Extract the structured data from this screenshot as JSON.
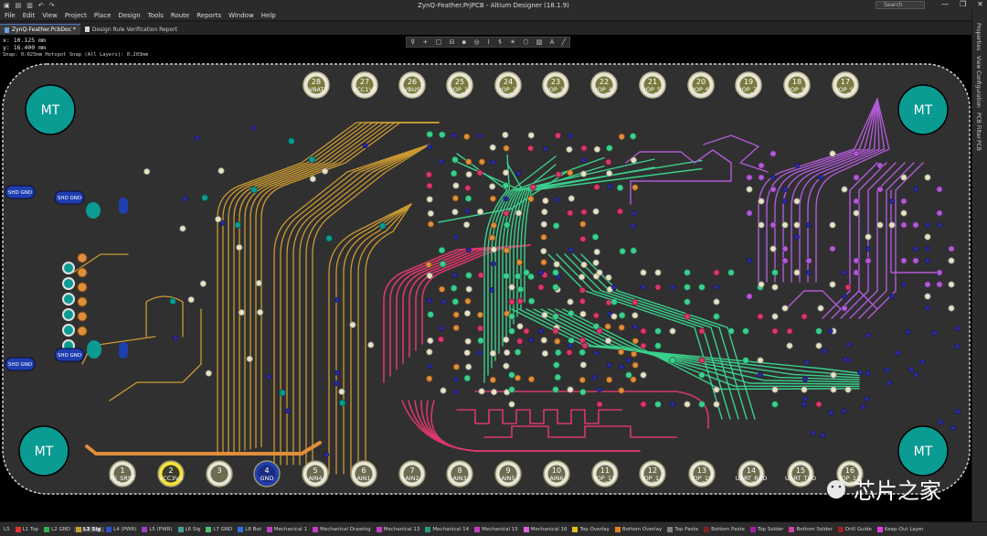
{
  "window": {
    "title": "ZynQ-Feather.PrjPCB - Altium Designer (18.1.9)",
    "search_placeholder": "Search",
    "controls": [
      "—",
      "❐",
      "✕"
    ]
  },
  "menubar": [
    "File",
    "Edit",
    "View",
    "Project",
    "Place",
    "Design",
    "Tools",
    "Route",
    "Reports",
    "Window",
    "Help"
  ],
  "tabs": [
    {
      "label": "ZynQ-Feather.PcbDoc *",
      "active": true
    },
    {
      "label": "Design Rule Verification Report",
      "active": false
    }
  ],
  "status": {
    "x": "x:  10.125 mm",
    "y": "y:  16.400 mm",
    "snap": "Snap: 0.025mm Hotspot Snap (All Layers): 0.203mm"
  },
  "toolbar_icons": [
    "filter-icon",
    "add-icon",
    "rect-select-icon",
    "align-icon",
    "place-component-icon",
    "hole-icon",
    "route-icon",
    "diffpair-icon",
    "bulb-icon",
    "polygon-icon",
    "region-icon",
    "text-icon",
    "line-icon"
  ],
  "right_panel": [
    "Properties",
    "View Configuration",
    "PCB Filter",
    "PCB"
  ],
  "pcb": {
    "colors": {
      "board": "#303030",
      "bottom_pad": "#e8e3c0",
      "mount": "#0a9b93",
      "orange": "#e08e3a",
      "gold": "#cc9a32",
      "green": "#3bd08c",
      "pink": "#d8386a",
      "purple": "#b15bd6",
      "via": "#2a2aa0"
    },
    "mount_label": "MT",
    "top_pads": [
      {
        "num": "28",
        "name": "VBAT"
      },
      {
        "num": "27",
        "name": "VCC1V0"
      },
      {
        "num": "26",
        "name": "VBUS"
      },
      {
        "num": "25",
        "name": "IOP_1"
      },
      {
        "num": "24",
        "name": "IOP_2"
      },
      {
        "num": "23",
        "name": "IOP_3"
      },
      {
        "num": "22",
        "name": "IOP_4"
      },
      {
        "num": "21",
        "name": "IOP_5"
      },
      {
        "num": "20",
        "name": "IOP_6"
      },
      {
        "num": "19",
        "name": "IOP_7"
      },
      {
        "num": "18",
        "name": "IOP_8"
      },
      {
        "num": "17",
        "name": "IOP_9"
      }
    ],
    "bottom_pads": [
      {
        "num": "1",
        "name": "PS_SRST"
      },
      {
        "num": "2",
        "name": "VCC3V3"
      },
      {
        "num": "3",
        "name": ""
      },
      {
        "num": "4",
        "name": "GND"
      },
      {
        "num": "5",
        "name": "AIN4"
      },
      {
        "num": "6",
        "name": "AIN1"
      },
      {
        "num": "7",
        "name": "AIN2"
      },
      {
        "num": "8",
        "name": "AIN3"
      },
      {
        "num": "9",
        "name": "AIN5"
      },
      {
        "num": "10",
        "name": "AIN6"
      },
      {
        "num": "11",
        "name": "IOP_12"
      },
      {
        "num": "12",
        "name": "IOP_11"
      },
      {
        "num": "13",
        "name": "IOP_10"
      },
      {
        "num": "14",
        "name": "UART_RXD"
      },
      {
        "num": "15",
        "name": "UART_TXD"
      },
      {
        "num": "16",
        "name": "IOP_13"
      }
    ],
    "shield_labels": [
      "SHD GND",
      "SHD GND",
      "SHD GND",
      "SHD GND"
    ],
    "watermark": "芯片之家"
  },
  "layers": [
    {
      "label": "L5",
      "color": "#888888"
    },
    {
      "label": "L1 Top",
      "color": "#e03030"
    },
    {
      "label": "L2 GND",
      "color": "#30b050"
    },
    {
      "label": "L3 Sig",
      "color": "#c0a030"
    },
    {
      "label": "L4 (PWR)",
      "color": "#3050d0"
    },
    {
      "label": "L5 (PWR)",
      "color": "#a040c0"
    },
    {
      "label": "L6 Sig",
      "color": "#40a0a0"
    },
    {
      "label": "L7 GND",
      "color": "#50c070"
    },
    {
      "label": "L8 Bot",
      "color": "#3070e0"
    },
    {
      "label": "Mechanical 1",
      "color": "#c040c0"
    },
    {
      "label": "Mechanical Drawing",
      "color": "#c040c0"
    },
    {
      "label": "Mechanical 13",
      "color": "#c040c0"
    },
    {
      "label": "Mechanical 14",
      "color": "#20a080"
    },
    {
      "label": "Mechanical 15",
      "color": "#c040c0"
    },
    {
      "label": "Mechanical 16",
      "color": "#e060e0"
    },
    {
      "label": "Top Overlay",
      "color": "#e0c020"
    },
    {
      "label": "Bottom Overlay",
      "color": "#e08020"
    },
    {
      "label": "Top Paste",
      "color": "#808080"
    },
    {
      "label": "Bottom Paste",
      "color": "#802020"
    },
    {
      "label": "Top Solder",
      "color": "#a020a0"
    },
    {
      "label": "Bottom Solder",
      "color": "#d040a0"
    },
    {
      "label": "Drill Guide",
      "color": "#a02020"
    },
    {
      "label": "Keep-Out Layer",
      "color": "#e040e0"
    }
  ],
  "active_layer": "L3 Sig"
}
